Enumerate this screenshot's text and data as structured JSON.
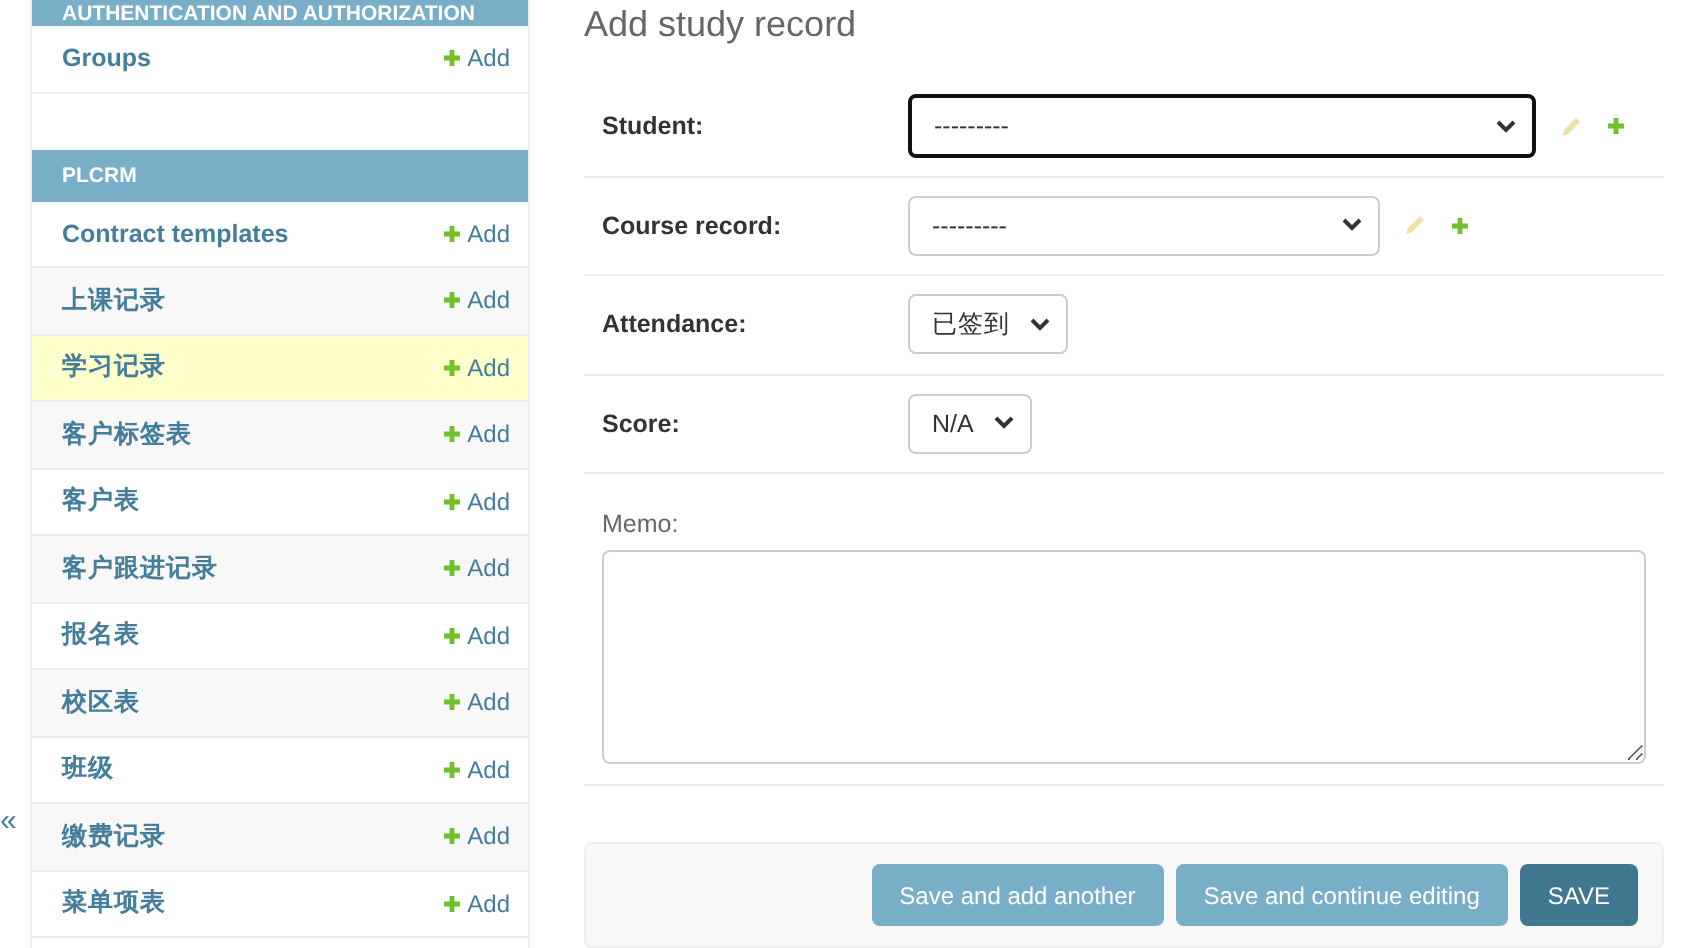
{
  "sidebar": {
    "collapse_toggle": "«",
    "modules": [
      {
        "caption": "AUTHENTICATION AND AUTHORIZATION",
        "models": [
          {
            "name": "Groups",
            "add": "Add",
            "selected": false
          }
        ]
      },
      {
        "caption": "PLCRM",
        "models": [
          {
            "name": "Contract templates",
            "add": "Add",
            "selected": false
          },
          {
            "name": "上课记录",
            "add": "Add",
            "selected": false
          },
          {
            "name": "学习记录",
            "add": "Add",
            "selected": true
          },
          {
            "name": "客户标签表",
            "add": "Add",
            "selected": false
          },
          {
            "name": "客户表",
            "add": "Add",
            "selected": false
          },
          {
            "name": "客户跟进记录",
            "add": "Add",
            "selected": false
          },
          {
            "name": "报名表",
            "add": "Add",
            "selected": false
          },
          {
            "name": "校区表",
            "add": "Add",
            "selected": false
          },
          {
            "name": "班级",
            "add": "Add",
            "selected": false
          },
          {
            "name": "缴费记录",
            "add": "Add",
            "selected": false
          },
          {
            "name": "菜单项表",
            "add": "Add",
            "selected": false
          }
        ]
      }
    ]
  },
  "title": "Add study record",
  "fields": [
    {
      "kind": "select",
      "label": "Student:",
      "value": "---------",
      "focused": true,
      "related_actions": true
    },
    {
      "kind": "select",
      "label": "Course record:",
      "value": "---------",
      "focused": false,
      "related_actions": true
    },
    {
      "kind": "select",
      "label": "Attendance:",
      "value": "已签到",
      "focused": false,
      "related_actions": false
    },
    {
      "kind": "select",
      "label": "Score:",
      "value": "N/A",
      "focused": false,
      "related_actions": false
    },
    {
      "kind": "textarea",
      "label": "Memo:",
      "focused": false,
      "related_actions": false
    }
  ],
  "buttons": [
    {
      "label": "Save and add another",
      "primary": false
    },
    {
      "label": "Save and continue editing",
      "primary": false
    },
    {
      "label": "SAVE",
      "primary": true
    }
  ]
}
